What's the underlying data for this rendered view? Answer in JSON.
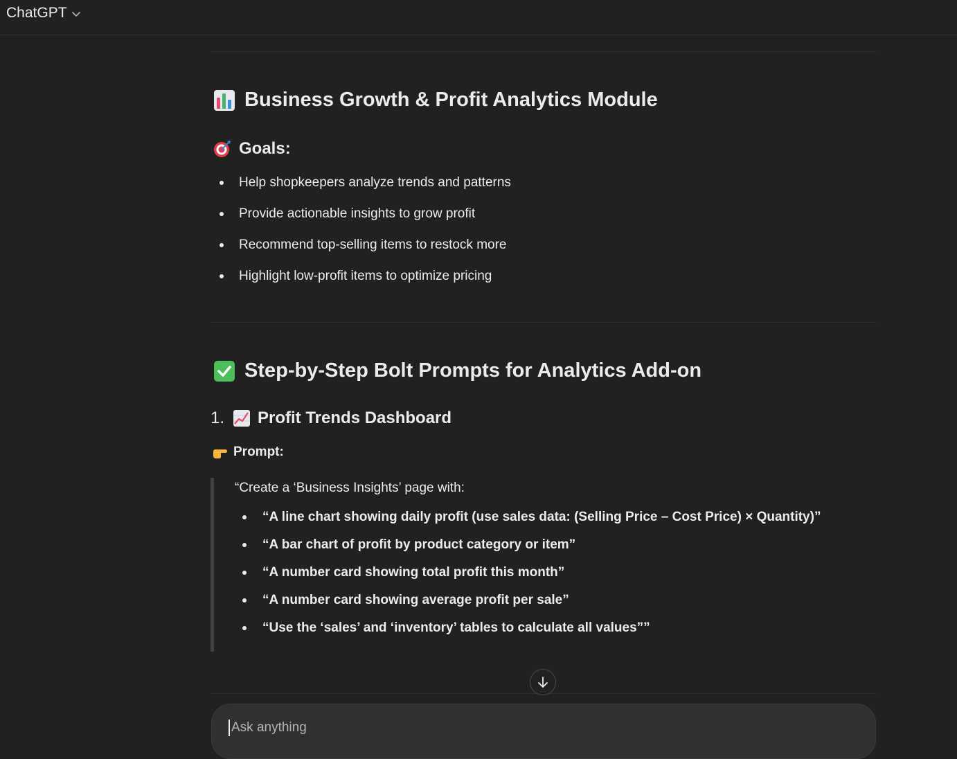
{
  "header": {
    "model_name": "ChatGPT"
  },
  "section_analytics": {
    "title": "Business Growth & Profit Analytics Module",
    "icon": "bar-chart-emoji"
  },
  "goals": {
    "title": "Goals:",
    "icon": "direct-hit-emoji",
    "items": [
      "Help shopkeepers analyze trends and patterns",
      "Provide actionable insights to grow profit",
      "Recommend top-selling items to restock more",
      "Highlight low-profit items to optimize pricing"
    ]
  },
  "section_steps": {
    "title": "Step-by-Step Bolt Prompts for Analytics Add-on",
    "icon": "check-mark-button-emoji"
  },
  "step1": {
    "number": "1.",
    "title": "Profit Trends Dashboard",
    "icon": "chart-increasing-emoji",
    "prompt_label": "Prompt:",
    "prompt_icon": "pointing-hand-emoji",
    "quote_intro": "“Create a ‘Business Insights’ page with:",
    "prompt_items": [
      "“A line chart showing daily profit (use sales data: (Selling Price – Cost Price) × Quantity)”",
      "“A bar chart of profit by product category or item”",
      "“A number card showing total profit this month”",
      "“A number card showing average profit per sale”",
      "“Use the ‘sales’ and ‘inventory’ tables to calculate all values””"
    ]
  },
  "composer": {
    "placeholder": "Ask anything"
  },
  "colors": {
    "background": "#212121",
    "text": "#ececec",
    "divider": "#2f2f2f",
    "composer_bg": "#303030"
  }
}
